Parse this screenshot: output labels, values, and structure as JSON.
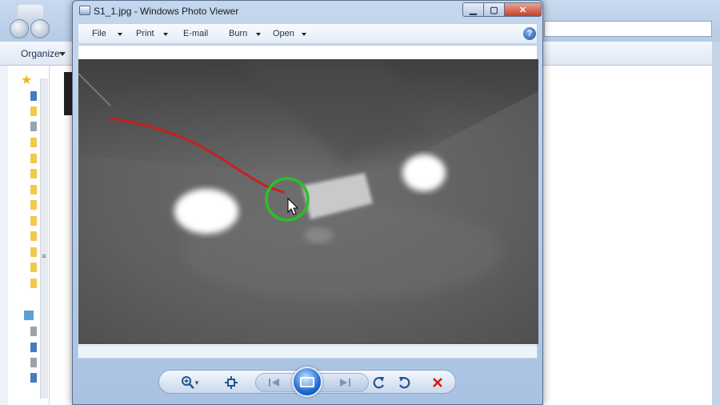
{
  "explorer": {
    "toolbar": {
      "organize_label": "Organize"
    }
  },
  "viewer": {
    "title": "S1_1.jpg - Windows Photo Viewer",
    "caption_buttons": {
      "minimize": "▁",
      "maximize": "▢",
      "close": "✕"
    },
    "menu": [
      {
        "label": "File",
        "has_dropdown": true
      },
      {
        "label": "Print",
        "has_dropdown": true
      },
      {
        "label": "E-mail",
        "has_dropdown": false
      },
      {
        "label": "Burn",
        "has_dropdown": true
      },
      {
        "label": "Open",
        "has_dropdown": true
      }
    ],
    "help_label": "?",
    "controls": {
      "zoom_icon": "magnifier-plus-icon",
      "actual_size_icon": "fit-window-icon",
      "previous_icon": "previous-icon",
      "slideshow_icon": "slideshow-icon",
      "next_icon": "next-icon",
      "rotate_ccw_icon": "rotate-counterclockwise-icon",
      "rotate_cw_icon": "rotate-clockwise-icon",
      "delete_icon": "delete-icon"
    }
  },
  "colors": {
    "annotation_track": "#d21a1a",
    "annotation_circle": "#2bbf2b",
    "delete": "#d11a1a",
    "accent": "#23538f"
  }
}
